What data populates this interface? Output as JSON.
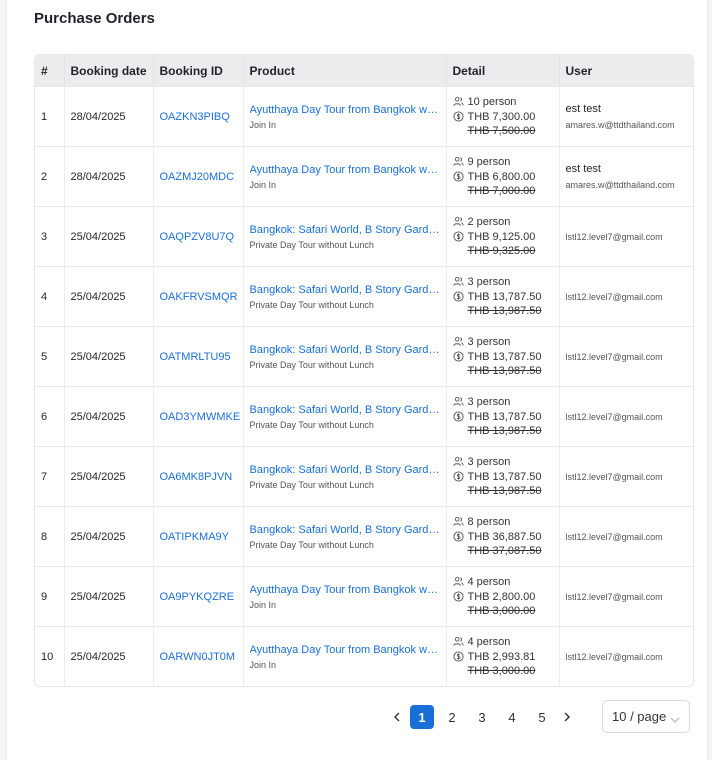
{
  "page": {
    "title": "Purchase Orders"
  },
  "table": {
    "headers": [
      "#",
      "Booking date",
      "Booking ID",
      "Product",
      "Detail",
      "User"
    ],
    "rows": [
      {
        "idx": "1",
        "date": "28/04/2025",
        "booking_id": "OAZKN3PIBQ",
        "product": "Ayutthaya Day Tour from Bangkok with...",
        "product_sub": "Join In",
        "persons": "10 person",
        "price": "THB 7,300.00",
        "old_price": "THB 7,500.00",
        "user_name": "est test",
        "user_email": "amares.w@ttdthailand.com"
      },
      {
        "idx": "2",
        "date": "28/04/2025",
        "booking_id": "OAZMJ20MDC",
        "product": "Ayutthaya Day Tour from Bangkok with...",
        "product_sub": "Join In",
        "persons": "9 person",
        "price": "THB 6,800.00",
        "old_price": "THB 7,000.00",
        "user_name": "est test",
        "user_email": "amares.w@ttdthailand.com"
      },
      {
        "idx": "3",
        "date": "25/04/2025",
        "booking_id": "OAQPZV8U7Q",
        "product": "Bangkok: Safari World, B Story Garden...",
        "product_sub": "Private Day Tour without Lunch",
        "persons": "2 person",
        "price": "THB 9,125.00",
        "old_price": "THB 9,325.00",
        "user_name": "",
        "user_email": "lstl12.level7@gmail.com"
      },
      {
        "idx": "4",
        "date": "25/04/2025",
        "booking_id": "OAKFRVSMQR",
        "product": "Bangkok: Safari World, B Story Garden...",
        "product_sub": "Private Day Tour without Lunch",
        "persons": "3 person",
        "price": "THB 13,787.50",
        "old_price": "THB 13,987.50",
        "user_name": "",
        "user_email": "lstl12.level7@gmail.com"
      },
      {
        "idx": "5",
        "date": "25/04/2025",
        "booking_id": "OATMRLTU95",
        "product": "Bangkok: Safari World, B Story Garden...",
        "product_sub": "Private Day Tour without Lunch",
        "persons": "3 person",
        "price": "THB 13,787.50",
        "old_price": "THB 13,987.50",
        "user_name": "",
        "user_email": "lstl12.level7@gmail.com"
      },
      {
        "idx": "6",
        "date": "25/04/2025",
        "booking_id": "OAD3YMWMKE",
        "product": "Bangkok: Safari World, B Story Garden...",
        "product_sub": "Private Day Tour without Lunch",
        "persons": "3 person",
        "price": "THB 13,787.50",
        "old_price": "THB 13,987.50",
        "user_name": "",
        "user_email": "lstl12.level7@gmail.com"
      },
      {
        "idx": "7",
        "date": "25/04/2025",
        "booking_id": "OA6MK8PJVN",
        "product": "Bangkok: Safari World, B Story Garden...",
        "product_sub": "Private Day Tour without Lunch",
        "persons": "3 person",
        "price": "THB 13,787.50",
        "old_price": "THB 13,987.50",
        "user_name": "",
        "user_email": "lstl12.level7@gmail.com"
      },
      {
        "idx": "8",
        "date": "25/04/2025",
        "booking_id": "OATIPKMA9Y",
        "product": "Bangkok: Safari World, B Story Garden...",
        "product_sub": "Private Day Tour without Lunch",
        "persons": "8 person",
        "price": "THB 36,887.50",
        "old_price": "THB 37,087.50",
        "user_name": "",
        "user_email": "lstl12.level7@gmail.com"
      },
      {
        "idx": "9",
        "date": "25/04/2025",
        "booking_id": "OA9PYKQZRE",
        "product": "Ayutthaya Day Tour from Bangkok with...",
        "product_sub": "Join In",
        "persons": "4 person",
        "price": "THB 2,800.00",
        "old_price": "THB 3,000.00",
        "user_name": "",
        "user_email": "lstl12.level7@gmail.com"
      },
      {
        "idx": "10",
        "date": "25/04/2025",
        "booking_id": "OARWN0JT0M",
        "product": "Ayutthaya Day Tour from Bangkok with...",
        "product_sub": "Join In",
        "persons": "4 person",
        "price": "THB 2,993.81",
        "old_price": "THB 3,000.00",
        "user_name": "",
        "user_email": "lstl12.level7@gmail.com"
      }
    ]
  },
  "pagination": {
    "prev_icon": "chevron-left-icon",
    "next_icon": "chevron-right-icon",
    "pages": [
      "1",
      "2",
      "3",
      "4",
      "5"
    ],
    "current": "1",
    "page_size": "10 / page"
  },
  "colors": {
    "link": "#1a6fd6",
    "active_page": "#1a6fd6",
    "header_bg": "#ececee"
  }
}
